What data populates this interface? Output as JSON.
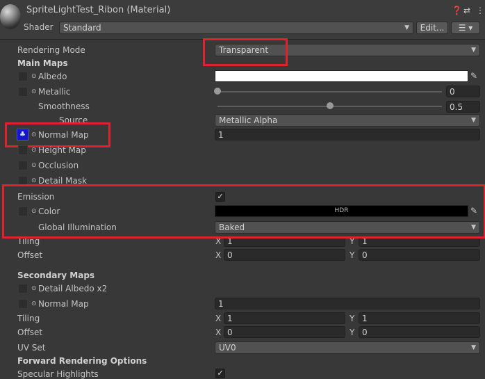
{
  "header": {
    "title": "SpriteLightTest_Ribon (Material)",
    "shader_label": "Shader",
    "shader_value": "Standard",
    "edit_label": "Edit...",
    "help_icon": "help-icon",
    "preset_icon": "presets-icon",
    "menu_icon": "kebab-menu-icon",
    "list_icon": "list-icon"
  },
  "rendering_mode": {
    "label": "Rendering Mode",
    "value": "Transparent"
  },
  "main_maps": {
    "heading": "Main Maps",
    "albedo": "Albedo",
    "metallic": "Metallic",
    "metallic_value": "0",
    "smoothness": "Smoothness",
    "smoothness_value": "0.5",
    "smoothness_level": 0.5,
    "source": "Source",
    "source_value": "Metallic Alpha",
    "normal_map": "Normal Map",
    "normal_value": "1",
    "height_map": "Height Map",
    "occlusion": "Occlusion",
    "detail_mask": "Detail Mask",
    "emission": "Emission",
    "emission_checked": "✓",
    "color": "Color",
    "hdr": "HDR",
    "global_illumination": "Global Illumination",
    "gi_value": "Baked",
    "tiling": "Tiling",
    "tiling_x": "1",
    "tiling_y": "1",
    "offset": "Offset",
    "offset_x": "0",
    "offset_y": "0"
  },
  "secondary_maps": {
    "heading": "Secondary Maps",
    "detail_albedo": "Detail Albedo x2",
    "normal_map": "Normal Map",
    "normal_value": "1",
    "tiling": "Tiling",
    "tiling_x": "1",
    "tiling_y": "1",
    "offset": "Offset",
    "offset_x": "0",
    "offset_y": "0",
    "uv_set": "UV Set",
    "uv_value": "UV0"
  },
  "forward": {
    "heading": "Forward Rendering Options",
    "specular": "Specular Highlights",
    "specular_checked": "✓"
  },
  "axis": {
    "x": "X",
    "y": "Y"
  },
  "colors": {
    "highlight": "#e0212e",
    "albedo": "#ffffff",
    "emission": "#000000"
  }
}
